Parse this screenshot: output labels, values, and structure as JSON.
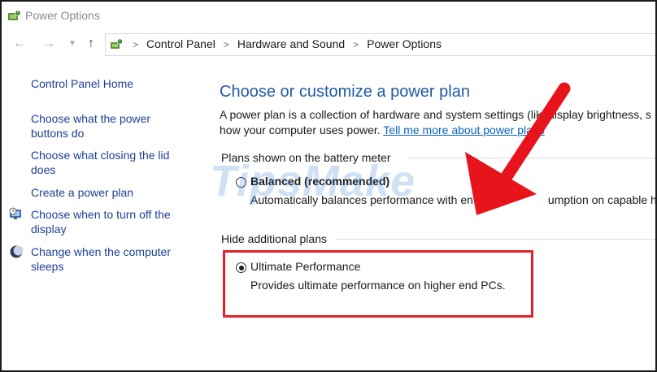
{
  "window": {
    "title": "Power Options",
    "icon": "power-options-icon"
  },
  "nav": {
    "back_icon": "back-arrow-icon",
    "forward_icon": "forward-arrow-icon",
    "recent_icon": "chevron-down-icon",
    "up_icon": "up-arrow-icon"
  },
  "breadcrumb": {
    "icon": "control-panel-icon",
    "items": [
      "Control Panel",
      "Hardware and Sound",
      "Power Options"
    ],
    "separator": ">"
  },
  "sidebar": {
    "home": "Control Panel Home",
    "items": [
      {
        "label_line1": "Choose what the power",
        "label_line2": "buttons do"
      },
      {
        "label_line1": "Choose what closing the lid",
        "label_line2": "does"
      },
      {
        "label_line1": "Create a power plan"
      },
      {
        "label_line1": "Choose when to turn off the",
        "label_line2": "display",
        "icon": "monitor-clock-icon"
      },
      {
        "label_line1": "Change when the computer",
        "label_line2": "sleeps",
        "icon": "moon-icon"
      }
    ]
  },
  "main": {
    "title": "Choose or customize a power plan",
    "description_line1": "A power plan is a collection of hardware and system settings (lik",
    "description_line1_cont": "display brightness, s",
    "description_line2": "how your computer uses power. ",
    "description_link": "Tell me more about power plans"
  },
  "battery_section": {
    "heading": "Plans shown on the battery meter",
    "plan": {
      "name": "Balanced (recommended)",
      "desc_part1": "Automatically balances performance with en",
      "desc_part2": "umption on capable har",
      "selected": false
    }
  },
  "additional_section": {
    "heading": "Hide additional plans",
    "plan": {
      "name": "Ultimate Performance",
      "desc": "Provides ultimate performance on higher end PCs.",
      "selected": true
    }
  },
  "watermark": "TipsMake",
  "colors": {
    "title_blue": "#1e5aa8",
    "link_blue": "#1c3f94",
    "highlight_red": "#e1202a"
  }
}
